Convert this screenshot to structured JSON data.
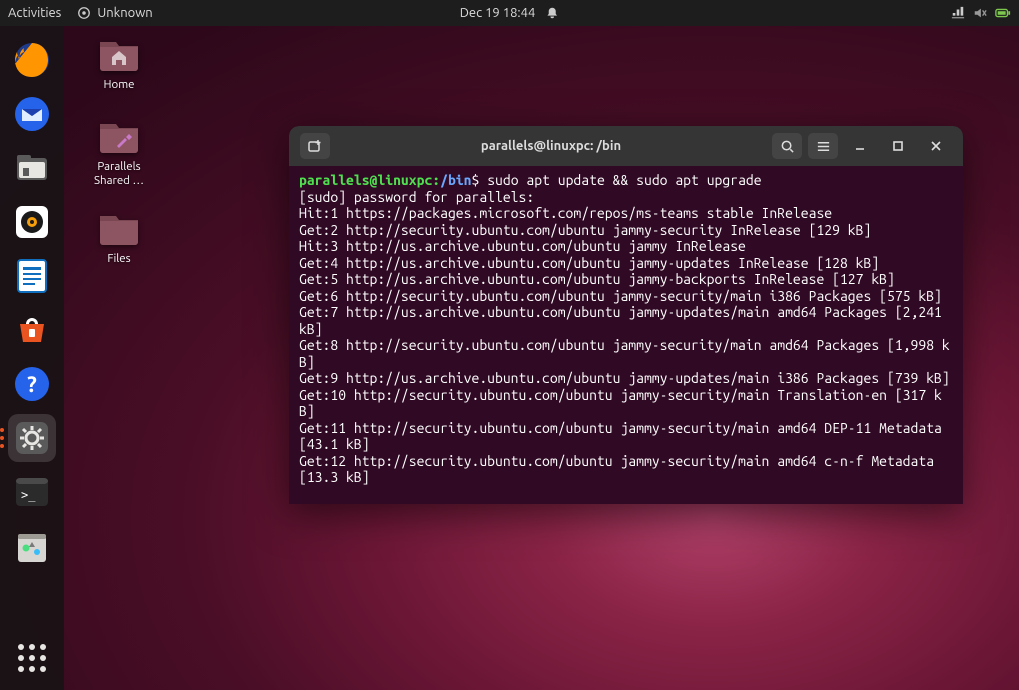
{
  "topbar": {
    "activities": "Activities",
    "app_name": "Unknown",
    "datetime": "Dec 19  18:44"
  },
  "desktop_icons": {
    "home": "Home",
    "parallels": "Parallels Shared …",
    "files": "Files"
  },
  "terminal": {
    "title": "parallels@linuxpc: /bin",
    "prompt_user": "parallels@linuxpc",
    "prompt_path": "/bin",
    "prompt_tail": "$ ",
    "command": "sudo apt update && sudo apt upgrade",
    "lines": [
      "[sudo] password for parallels:",
      "Hit:1 https://packages.microsoft.com/repos/ms-teams stable InRelease",
      "Get:2 http://security.ubuntu.com/ubuntu jammy-security InRelease [129 kB]",
      "Hit:3 http://us.archive.ubuntu.com/ubuntu jammy InRelease",
      "Get:4 http://us.archive.ubuntu.com/ubuntu jammy-updates InRelease [128 kB]",
      "Get:5 http://us.archive.ubuntu.com/ubuntu jammy-backports InRelease [127 kB]",
      "Get:6 http://security.ubuntu.com/ubuntu jammy-security/main i386 Packages [575 kB]",
      "Get:7 http://us.archive.ubuntu.com/ubuntu jammy-updates/main amd64 Packages [2,241 kB]",
      "Get:8 http://security.ubuntu.com/ubuntu jammy-security/main amd64 Packages [1,998 kB]",
      "Get:9 http://us.archive.ubuntu.com/ubuntu jammy-updates/main i386 Packages [739 kB]",
      "Get:10 http://security.ubuntu.com/ubuntu jammy-security/main Translation-en [317 kB]",
      "Get:11 http://security.ubuntu.com/ubuntu jammy-security/main amd64 DEP-11 Metadata [43.1 kB]",
      "Get:12 http://security.ubuntu.com/ubuntu jammy-security/main amd64 c-n-f Metadata [13.3 kB]"
    ]
  }
}
